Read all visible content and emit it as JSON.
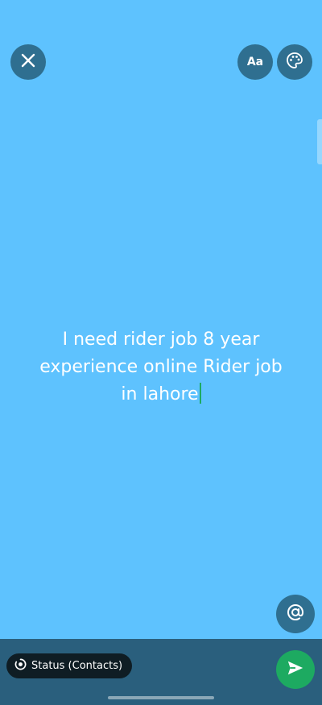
{
  "status": {
    "text": "I need rider job 8 year\nexperience online Rider job\nin lahore"
  },
  "toolbar": {
    "font_label": "Aa",
    "icons": {
      "close": "close-icon",
      "font": "font-icon",
      "palette": "palette-icon",
      "mention": "at-sign-icon",
      "send": "send-icon",
      "audience": "status-icon"
    }
  },
  "bottom_bar": {
    "audience_label": "Status (Contacts)"
  },
  "colors": {
    "background": "#5ec2fe",
    "button": "#2f6f90",
    "bottom_bar": "#2a5f7d",
    "chip": "#0f1d24",
    "send": "#1daa61",
    "caret": "#1daa61"
  }
}
